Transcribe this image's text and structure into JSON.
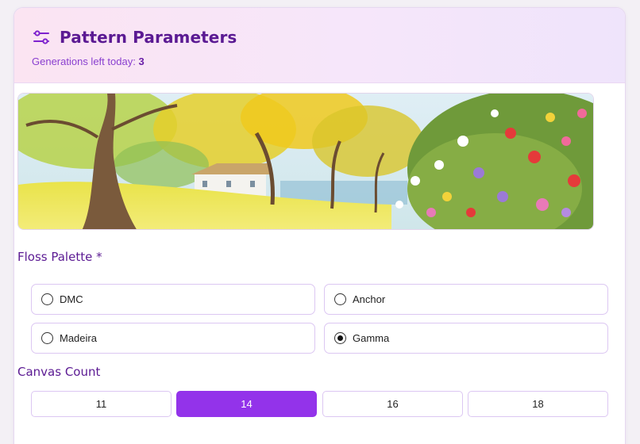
{
  "header": {
    "title": "Pattern Parameters",
    "generations_label": "Generations left today:",
    "generations_count": "3",
    "icon": "sliders-icon"
  },
  "hero_image": {
    "description_icon": "watercolor-landscape-image"
  },
  "floss_palette": {
    "label": "Floss Palette *",
    "options": [
      {
        "label": "DMC",
        "checked": false
      },
      {
        "label": "Anchor",
        "checked": false
      },
      {
        "label": "Madeira",
        "checked": false
      },
      {
        "label": "Gamma",
        "checked": true
      }
    ]
  },
  "canvas_count": {
    "label": "Canvas Count",
    "options": [
      {
        "label": "11",
        "active": false
      },
      {
        "label": "14",
        "active": true
      },
      {
        "label": "16",
        "active": false
      },
      {
        "label": "18",
        "active": false
      }
    ]
  },
  "colors": {
    "accent": "#9333ea",
    "title": "#5b1a93",
    "border": "#dcc7f2"
  }
}
